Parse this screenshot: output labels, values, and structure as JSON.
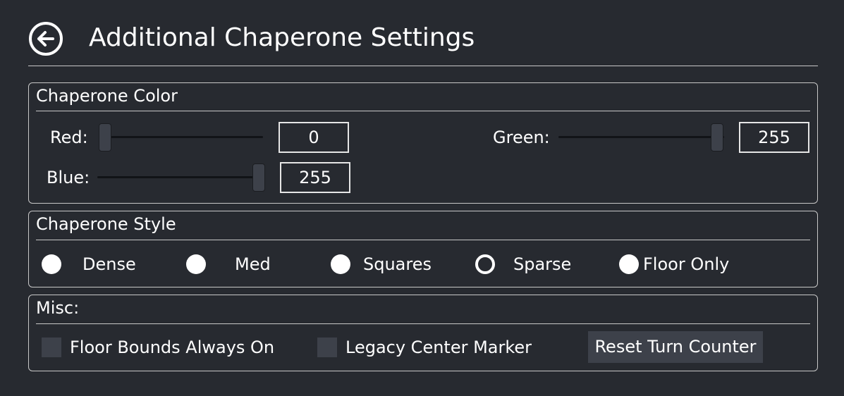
{
  "header": {
    "title": "Additional Chaperone Settings",
    "back_icon": "arrow-left-circle-icon"
  },
  "color": {
    "title": "Chaperone Color",
    "red": {
      "label": "Red:",
      "value": "0",
      "level": 0
    },
    "green": {
      "label": "Green:",
      "value": "255",
      "level": 255
    },
    "blue": {
      "label": "Blue:",
      "value": "255",
      "level": 255
    },
    "max": 255
  },
  "style": {
    "title": "Chaperone Style",
    "options": [
      {
        "label": "Dense",
        "selected": false
      },
      {
        "label": "Med",
        "selected": false
      },
      {
        "label": "Squares",
        "selected": false
      },
      {
        "label": "Sparse",
        "selected": true
      },
      {
        "label": "Floor Only",
        "selected": false
      }
    ]
  },
  "misc": {
    "title": "Misc:",
    "floor_bounds_label": "Floor Bounds Always On",
    "floor_bounds_checked": false,
    "legacy_marker_label": "Legacy Center Marker",
    "legacy_marker_checked": false,
    "reset_label": "Reset Turn Counter"
  },
  "colors": {
    "background": "#272a30",
    "control": "#3d414a",
    "border": "#c8c8c8",
    "text": "#ffffff"
  }
}
